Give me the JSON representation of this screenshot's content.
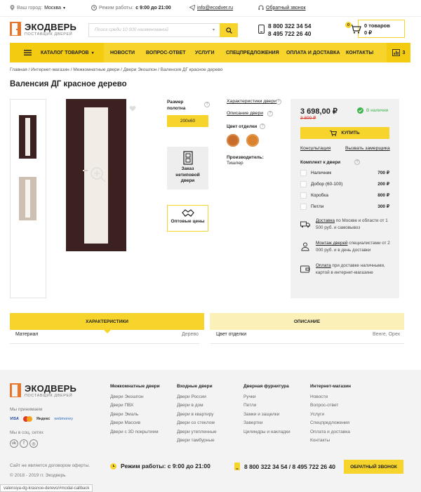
{
  "topbar": {
    "city_label": "Ваш город:",
    "city_value": "Москва",
    "hours_label": "Режим работы:",
    "hours_value": "с 9:00 до 21:00",
    "email": "info@ecodver.ru",
    "callback": "Обратный звонок"
  },
  "header": {
    "logo_title": "ЭКОДВЕРЬ",
    "logo_subtitle": "ПОСТАВЩИК ДВЕРЕЙ",
    "search_placeholder": "Поиск среди 10 000 наименований",
    "phone1": "8 800 322 34 54",
    "phone2": "8 495 722 26 40",
    "cart_count": "0",
    "cart_items": "0 товаров",
    "cart_sum": "0 ₽"
  },
  "nav": {
    "catalog": "КАТАЛОГ ТОВАРОВ",
    "items": [
      "НОВОСТИ",
      "ВОПРОС-ОТВЕТ",
      "УСЛУГИ",
      "СПЕЦПРЕДЛОЖЕНИЯ",
      "ОПЛАТА И ДОСТАВКА",
      "КОНТАКТЫ"
    ],
    "compare_count": "3"
  },
  "breadcrumb": [
    "Главная",
    "Интернет-магазин",
    "Межкомнатные двери",
    "Двери Экошпон",
    "Валенсия ДГ красное дерево"
  ],
  "product": {
    "title": "Валенсия ДГ красное дерево",
    "size_label": "Размер полотна",
    "size_value": "200х60",
    "custom_door": "Заказ нетиповой двери",
    "wholesale": "Оптовые цены",
    "link_characteristics": "Характеристики двери",
    "link_description": "Описание двери",
    "finish_label": "Цвет отделки",
    "maker_label": "Производитель:",
    "maker_value": "Тишлер"
  },
  "buy": {
    "price": "3 698,00 ₽",
    "old_price": "3 800 ₽",
    "stock": "В наличии",
    "buy_button": "КУПИТЬ",
    "consult": "Консультация",
    "measurer": "Вызвать замерщика",
    "kit_title": "Комплект к двери",
    "kit": [
      {
        "name": "Наличник",
        "price": "700 ₽"
      },
      {
        "name": "Добор (60-100)",
        "price": "200 ₽"
      },
      {
        "name": "Коробка",
        "price": "800 ₽"
      },
      {
        "name": "Петли",
        "price": "300 ₽"
      }
    ],
    "delivery_link": "Доставка",
    "delivery_text": "по Москве и области от 1 500 руб. и самовывоз",
    "install_link": "Монтаж дверей",
    "install_text": "специалистами от 2 000 руб. и в день доставки",
    "pay_link": "Оплата",
    "pay_text": "при доставке наличными, картой в интернет-магазине"
  },
  "tabs": {
    "left": "ХАРАКТЕРИСТИКИ",
    "right": "ОПИСАНИЕ",
    "left_key": "Материал",
    "left_val": "Дерево",
    "right_key": "Цвет отделки",
    "right_val": "Венге, Орех"
  },
  "footer": {
    "logo_title": "ЭКОДВЕРЬ",
    "logo_subtitle": "ПОСТАВЩИК ДВЕРЕЙ",
    "we_accept": "Мы принимаем",
    "payments": [
      "VISA",
      "MC",
      "Яндекс",
      "webmoney"
    ],
    "social_label": "Мы в соц. сетях",
    "col1_title": "Межкомнатные двери",
    "col1": [
      "Двери Экошпон",
      "Двери ПВХ",
      "Двери Эмаль",
      "Двери Массив",
      "Двери с 3D покрытием"
    ],
    "col2_title": "Входные двери",
    "col2": [
      "Двери России",
      "Двери в дом",
      "Двери в квартиру",
      "Двери со стеклом",
      "Двери утепленные",
      "Двери тамбурные"
    ],
    "col3_title": "Дверная фурнитура",
    "col3": [
      "Ручки",
      "Петли",
      "Замки и защелки",
      "Завертки",
      "Цилиндры и накладки"
    ],
    "col4_title": "Интернет-магазин",
    "col4": [
      "Новости",
      "Вопрос-ответ",
      "Услуги",
      "Спецпредложения",
      "Оплата и доставка",
      "Контакты"
    ],
    "disclaimer": "Сайт не является договором оферты.",
    "copyright": "© 2018 - 2019 гг. Экодверь",
    "hours": "Режим работы: с 9:00 до 21:00",
    "phones": "8 800 322 34 54 / 8 495 722 26 40",
    "callback_button": "ОБРАТНЫЙ ЗВОНОК",
    "status_url": "valensiya-dg-krasnoe-derevo/#modal-callback"
  },
  "colors": {
    "accent": "#f6d42c",
    "green": "#3bb54a",
    "red": "#d9342b"
  }
}
